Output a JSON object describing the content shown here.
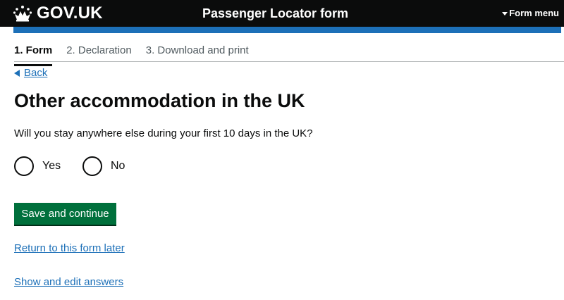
{
  "header": {
    "logo_text": "GOV.UK",
    "logo_icon": "crown-icon",
    "service_name": "Passenger Locator form",
    "form_menu_label": "Form menu"
  },
  "steps": [
    {
      "label": "1. Form",
      "active": true
    },
    {
      "label": "2. Declaration",
      "active": false
    },
    {
      "label": "3. Download and print",
      "active": false
    }
  ],
  "back_link": "Back",
  "page_title": "Other accommodation in the UK",
  "question": "Will you stay anywhere else during your first 10 days in the UK?",
  "options": [
    {
      "label": "Yes",
      "selected": false
    },
    {
      "label": "No",
      "selected": false
    }
  ],
  "primary_button": "Save and continue",
  "links": {
    "return_later": "Return to this form later",
    "show_edit": "Show and edit answers"
  },
  "colors": {
    "header_bg": "#0b0c0c",
    "brand_blue": "#1d70b8",
    "button_green": "#00703c",
    "link": "#1d70b8"
  }
}
